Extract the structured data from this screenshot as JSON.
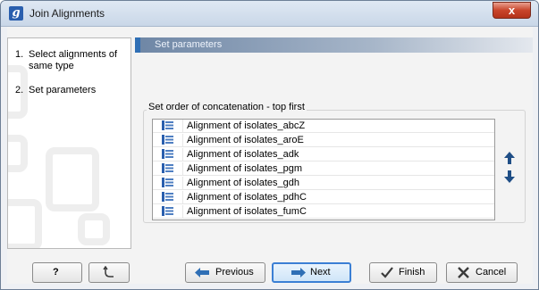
{
  "window": {
    "title": "Join Alignments",
    "app_icon_glyph": "g",
    "close_glyph": "x"
  },
  "steps": [
    {
      "number": "1.",
      "label": "Select alignments of same type"
    },
    {
      "number": "2.",
      "label": "Set parameters"
    }
  ],
  "section": {
    "title": "Set parameters"
  },
  "order_group": {
    "label": "Set order of concatenation - top first",
    "items": [
      "Alignment of isolates_abcZ",
      "Alignment of isolates_aroE",
      "Alignment of isolates_adk",
      "Alignment of isolates_pgm",
      "Alignment of isolates_gdh",
      "Alignment of isolates_pdhC",
      "Alignment of isolates_fumC"
    ],
    "item_icon": "alignment-icon",
    "move_up_glyph": "🡅",
    "move_down_glyph": "🡇"
  },
  "buttons": {
    "help": "?",
    "reset_icon": "reset-icon",
    "previous": "Previous",
    "next": "Next",
    "finish": "Finish",
    "cancel": "Cancel"
  },
  "colors": {
    "accent": "#2f6fb5",
    "section_bar": "#6e86a5",
    "close_button": "#c9452b",
    "focus_border": "#3b7fd4"
  }
}
